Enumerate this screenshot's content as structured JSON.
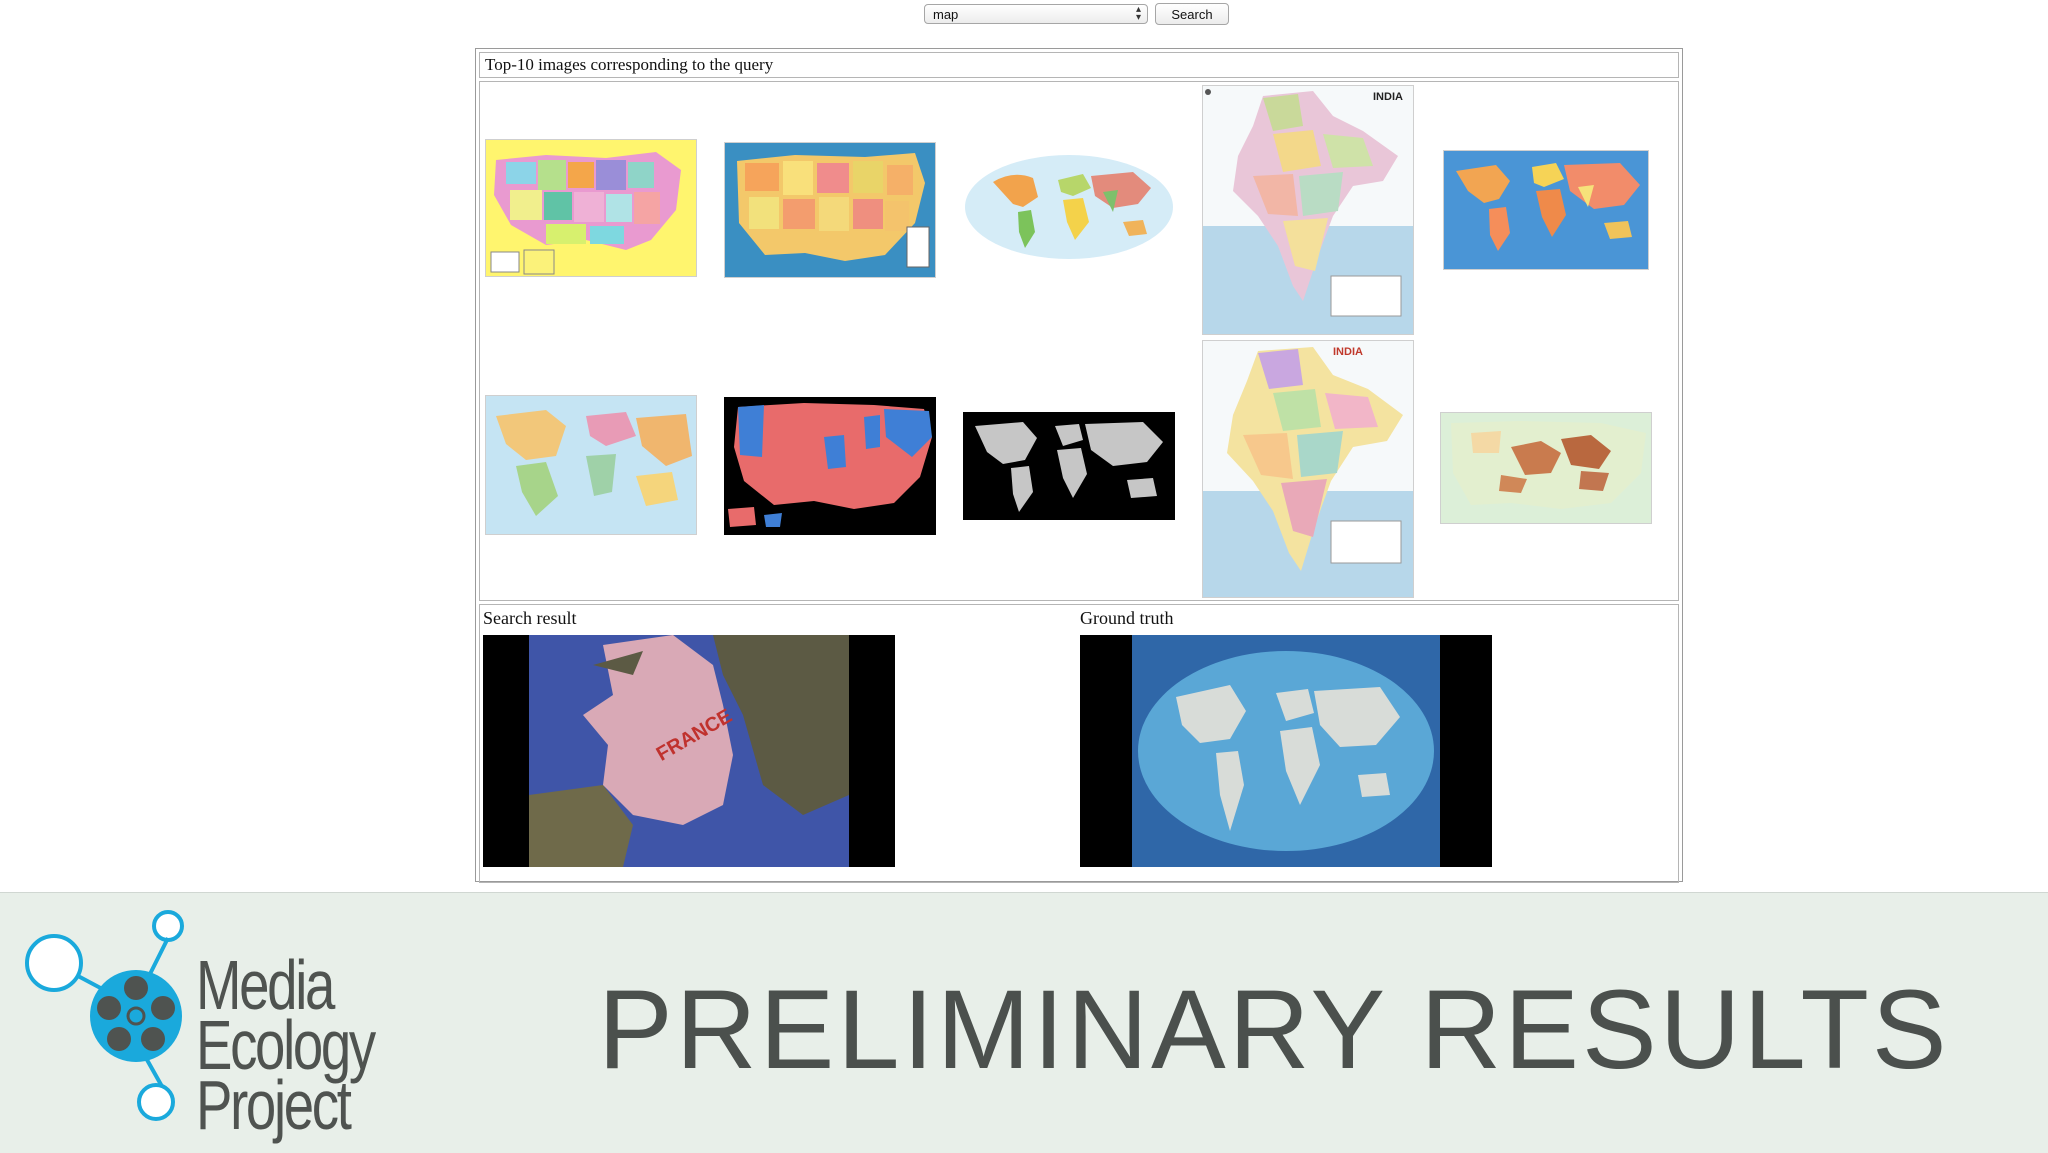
{
  "query": {
    "selected_option": "map",
    "search_label": "Search"
  },
  "results": {
    "caption": "Top-10 images corresponding to the query",
    "thumbnails": [
      {
        "name": "usa-states-map-color",
        "label": ""
      },
      {
        "name": "usa-political-map",
        "label": ""
      },
      {
        "name": "world-map-oval",
        "label": ""
      },
      {
        "name": "india-map",
        "label": "INDIA"
      },
      {
        "name": "world-political-map",
        "label": ""
      },
      {
        "name": "world-physical-map",
        "label": ""
      },
      {
        "name": "usa-red-blue-map",
        "label": ""
      },
      {
        "name": "world-map-gray-black",
        "label": ""
      },
      {
        "name": "india-states-map",
        "label": "INDIA"
      },
      {
        "name": "usa-terrain-map",
        "label": ""
      }
    ]
  },
  "comparison": {
    "search_result_label": "Search result",
    "ground_truth_label": "Ground truth",
    "search_result_map_text": "FRANCE"
  },
  "footer": {
    "logo_words": [
      "Media",
      "Ecology",
      "Project"
    ],
    "headline": "PRELIMINARY RESULTS"
  },
  "colors": {
    "footer_bg": "#e8efe9",
    "logo_blue": "#1aa9dc",
    "headline_text": "#4b504d"
  }
}
